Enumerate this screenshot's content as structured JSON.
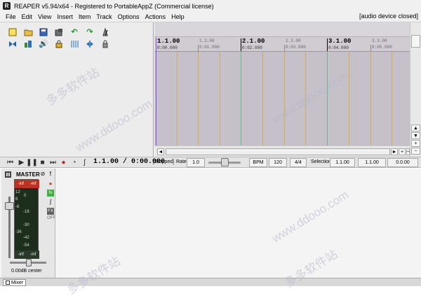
{
  "window": {
    "title": "REAPER v5.94/x64 - Registered to PortableAppZ (Commercial license)",
    "app_icon": "R"
  },
  "menu": {
    "items": [
      "File",
      "Edit",
      "View",
      "Insert",
      "Item",
      "Track",
      "Options",
      "Actions",
      "Help"
    ],
    "status": "[audio device closed]"
  },
  "toolbar": {
    "row1": [
      "new-project-icon",
      "open-project-icon",
      "save-project-icon",
      "project-settings-icon",
      "undo-icon",
      "redo-icon",
      "metronome-icon"
    ],
    "row2": [
      "auto-crossfade-icon",
      "envelope-follows-icon",
      "ripple-edit-icon",
      "lock-toggle-icon",
      "grid-toggle-icon",
      "snap-toggle-icon",
      "lock-settings-icon"
    ]
  },
  "ruler": {
    "bars": [
      {
        "label": "1.1.00",
        "sub": "0:00.000"
      },
      {
        "label": "2.1.00",
        "sub": "0:02.000"
      },
      {
        "label": "3.1.00",
        "sub": "0:04.000"
      }
    ],
    "minors": [
      {
        "label": "1.3.00",
        "sub": "0:01.000"
      },
      {
        "label": "2.3.00",
        "sub": "0:03.000"
      },
      {
        "label": "3.3.00",
        "sub": "0:05.000"
      }
    ]
  },
  "transport": {
    "time": "1.1.00 / 0:00.000",
    "state": "[Stopped]",
    "rate_label": "Rate:",
    "rate_value": "1.0",
    "bpm_label": "BPM",
    "bpm_value": "120",
    "time_sig": "4/4",
    "selection_label": "Selection:",
    "sel_start": "1.1.00",
    "sel_end": "1.1.00",
    "sel_length": "0.0.00"
  },
  "master": {
    "label": "MASTER",
    "peak_left": "-inf",
    "peak_right": "-inf",
    "foot_left": "-inf",
    "foot_right": "-inf",
    "scale": [
      "12",
      "6",
      "0",
      "-6",
      "-18",
      "-30",
      "-36",
      "-42",
      "-54"
    ],
    "volume_label": "0.00dB center",
    "fx_off_label": "OFF"
  },
  "mixer_tab": {
    "label": "Mixer"
  },
  "watermark": [
    "多多软件站",
    "www.ddooo.com"
  ]
}
